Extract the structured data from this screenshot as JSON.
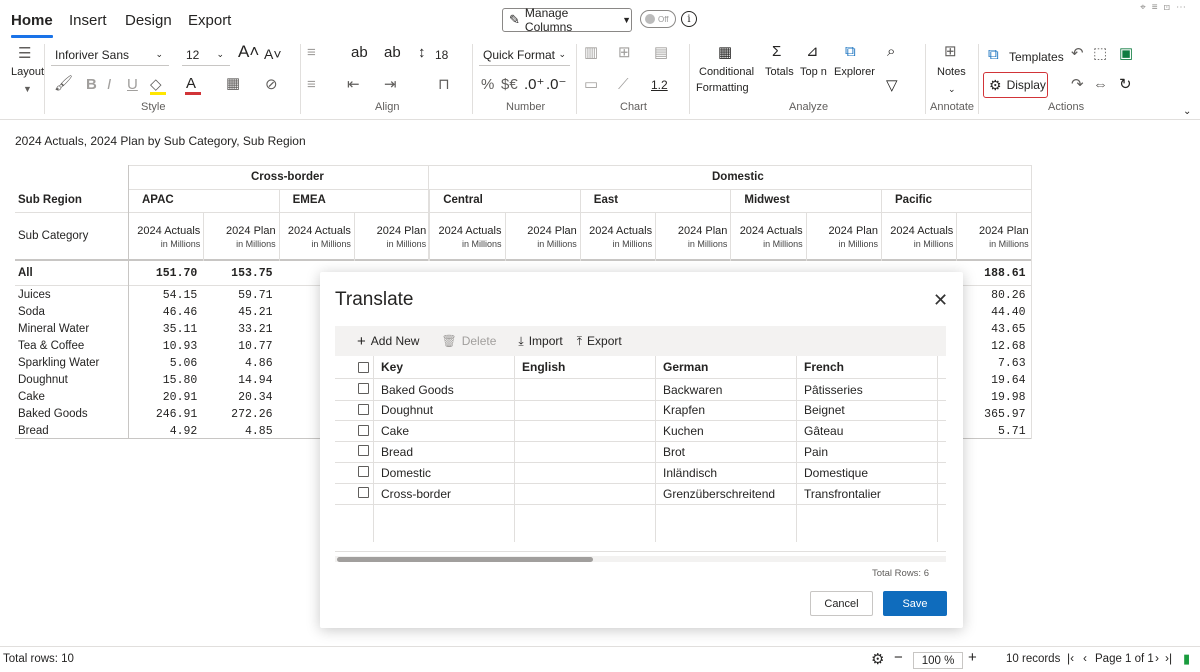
{
  "tabs": [
    "Home",
    "Insert",
    "Design",
    "Export"
  ],
  "manage_columns": "Manage Columns",
  "toggle_label": "Off",
  "ribbon": {
    "layout": "Layout",
    "font_family": "Inforiver Sans",
    "font_size": "12",
    "quick_format": "Quick Format",
    "row_height": "18",
    "currency": "$€",
    "decimal_inc": ".0⁺",
    "decimal_dec": ".0⁻",
    "num_format": "1.2",
    "conditional": "Conditional",
    "formatting": "Formatting",
    "totals": "Totals",
    "topn": "Top n",
    "explorer": "Explorer",
    "notes": "Notes",
    "templates": "Templates",
    "display": "Display",
    "groups": {
      "style": "Style",
      "align": "Align",
      "number": "Number",
      "chart": "Chart",
      "analyze": "Analyze",
      "annotate": "Annotate",
      "actions": "Actions"
    }
  },
  "viz_title": "2024 Actuals, 2024 Plan by Sub Category, Sub Region",
  "table": {
    "group_headers": [
      "Cross-border",
      "Domestic"
    ],
    "row_header_region": "Sub Region",
    "row_header_category": "Sub Category",
    "regions": [
      "APAC",
      "EMEA",
      "Central",
      "East",
      "Midwest",
      "Pacific"
    ],
    "measure_actual": "2024 Actuals",
    "measure_plan": "2024 Plan",
    "unit": "in Millions",
    "total_label": "All",
    "total_values": [
      "151.70",
      "153.75",
      "",
      "",
      "",
      "",
      "",
      "",
      "",
      "",
      "",
      "188.61"
    ],
    "rows": [
      {
        "label": "Juices",
        "values": [
          "54.15",
          "59.71",
          "80.26"
        ]
      },
      {
        "label": "Soda",
        "values": [
          "46.46",
          "45.21",
          "44.40"
        ]
      },
      {
        "label": "Mineral Water",
        "values": [
          "35.11",
          "33.21",
          "43.65"
        ]
      },
      {
        "label": "Tea & Coffee",
        "values": [
          "10.93",
          "10.77",
          "12.68"
        ]
      },
      {
        "label": "Sparkling Water",
        "values": [
          "5.06",
          "4.86",
          "7.63"
        ]
      },
      {
        "label": "Doughnut",
        "values": [
          "15.80",
          "14.94",
          "19.64"
        ]
      },
      {
        "label": "Cake",
        "values": [
          "20.91",
          "20.34",
          "19.98"
        ]
      },
      {
        "label": "Baked Goods",
        "values": [
          "246.91",
          "272.26",
          "365.97"
        ]
      },
      {
        "label": "Bread",
        "values": [
          "4.92",
          "4.85",
          "5.71"
        ]
      }
    ]
  },
  "dialog": {
    "title": "Translate",
    "toolbar": {
      "add": "Add New",
      "delete": "Delete",
      "import": "Import",
      "export": "Export"
    },
    "columns": [
      "Key",
      "English",
      "German",
      "French"
    ],
    "rows": [
      {
        "key": "Baked Goods",
        "english": "",
        "german": "Backwaren",
        "french": "Pâtisseries"
      },
      {
        "key": "Doughnut",
        "english": "",
        "german": "Krapfen",
        "french": "Beignet"
      },
      {
        "key": "Cake",
        "english": "",
        "german": "Kuchen",
        "french": "Gâteau"
      },
      {
        "key": "Bread",
        "english": "",
        "german": "Brot",
        "french": "Pain"
      },
      {
        "key": "Domestic",
        "english": "",
        "german": "Inländisch",
        "french": "Domestique"
      },
      {
        "key": "Cross-border",
        "english": "",
        "german": "Grenzüberschreitend",
        "french": "Transfrontalier"
      }
    ],
    "total_rows": "Total Rows: 6",
    "cancel": "Cancel",
    "save": "Save"
  },
  "status": {
    "total_rows": "Total rows: 10",
    "zoom": "100 %",
    "records": "10 records",
    "page": "Page 1 of 1"
  },
  "colors": {
    "accent": "#0f6cbd",
    "highlight": "#d13438",
    "tab_underline": "#1a73e8"
  }
}
